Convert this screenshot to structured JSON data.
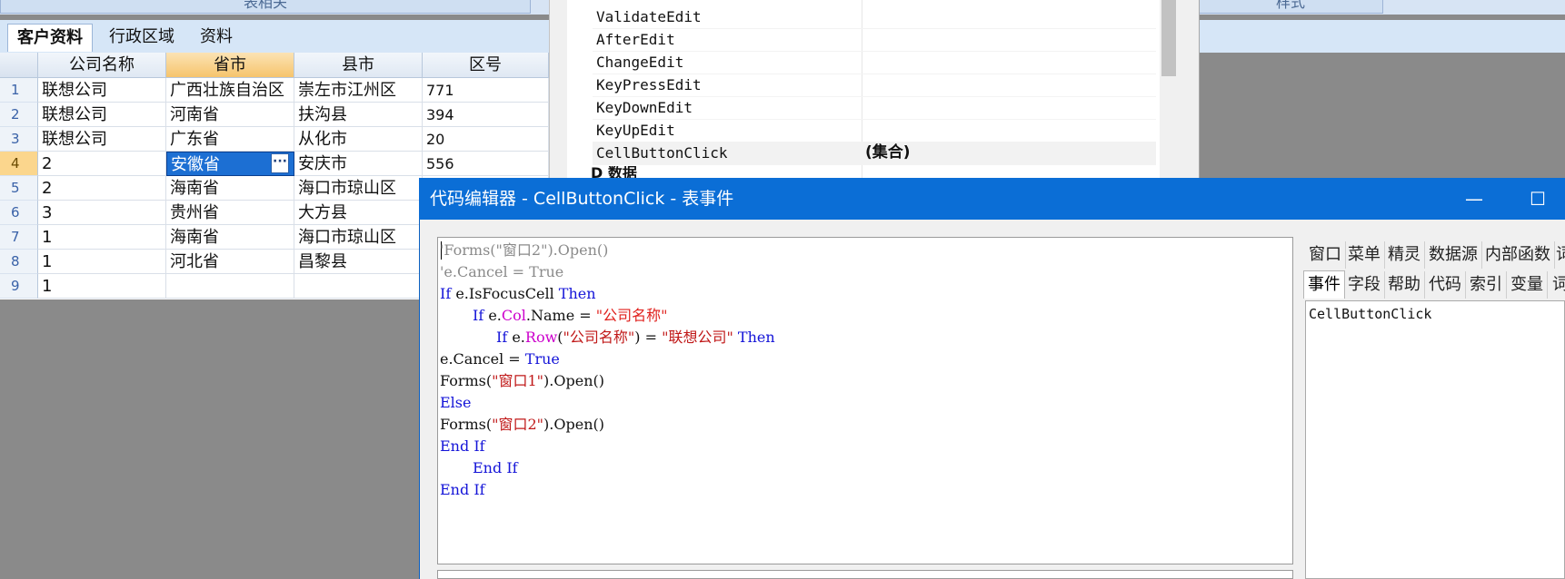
{
  "ribbon": {
    "buttons": [
      "表相关",
      "样式"
    ]
  },
  "tabs": [
    {
      "label": "客户资料",
      "active": true
    },
    {
      "label": "行政区域",
      "active": false
    },
    {
      "label": "资料",
      "active": false
    }
  ],
  "grid": {
    "columns": [
      "公司名称",
      "省市",
      "县市",
      "区号"
    ],
    "selected_column": "省市",
    "rows": [
      {
        "n": "1",
        "c1": "联想公司",
        "c2": "广西壮族自治区",
        "c3": "崇左市江州区",
        "c4": "771"
      },
      {
        "n": "2",
        "c1": "联想公司",
        "c2": "河南省",
        "c3": "扶沟县",
        "c4": "394"
      },
      {
        "n": "3",
        "c1": "联想公司",
        "c2": "广东省",
        "c3": "从化市",
        "c4": "20"
      },
      {
        "n": "4",
        "c1": "2",
        "c2": "安徽省",
        "c3": "安庆市",
        "c4": "556"
      },
      {
        "n": "5",
        "c1": "2",
        "c2": "海南省",
        "c3": "海口市琼山区",
        "c4": ""
      },
      {
        "n": "6",
        "c1": "3",
        "c2": "贵州省",
        "c3": "大方县",
        "c4": ""
      },
      {
        "n": "7",
        "c1": "1",
        "c2": "海南省",
        "c3": "海口市琼山区",
        "c4": ""
      },
      {
        "n": "8",
        "c1": "1",
        "c2": "河北省",
        "c3": "昌黎县",
        "c4": ""
      },
      {
        "n": "9",
        "c1": "1",
        "c2": "",
        "c3": "",
        "c4": ""
      }
    ],
    "cell_button_glyph": "···"
  },
  "properties": {
    "events": [
      "ValidateEdit",
      "AfterEdit",
      "ChangeEdit",
      "KeyPressEdit",
      "KeyDownEdit",
      "KeyUpEdit",
      "CellButtonClick"
    ],
    "cellbuttonclick_value": "(集合)",
    "category_partial": "D 数据"
  },
  "editor": {
    "title": "代码编辑器 - CellButtonClick - 表事件",
    "minimize_glyph": "—",
    "maximize_glyph": "☐",
    "code": {
      "l1_a": "'Forms(",
      "l1_b": "\"窗口2\"",
      "l1_c": ").Open()",
      "l2": "'e.Cancel = True",
      "l3_kw": "If",
      "l3_a": " e.IsFocusCell ",
      "l3_kw2": "Then",
      "l4_kw": "If",
      "l4_a": " e.",
      "l4_prop": "Col",
      "l4_b": ".Name = ",
      "l4_str": "\"公司名称\"",
      "l5_kw": "If",
      "l5_a": " e.",
      "l5_prop": "Row",
      "l5_b": "(",
      "l5_str": "\"公司名称\"",
      "l5_c": ") = ",
      "l5_str2": "\"联想公司\"",
      "l5_kw2": " Then",
      "l6_a": "e.Cancel = ",
      "l6_kw": "True",
      "l7_a": "Forms(",
      "l7_str": "\"窗口1\"",
      "l7_b": ").Open()",
      "l8_kw": "Else",
      "l9_a": "Forms(",
      "l9_str": "\"窗口2\"",
      "l9_b": ").Open()",
      "l10_kw": "End If",
      "l11_kw": "End If",
      "l12_kw": "End If"
    },
    "right_tabs_row1": [
      "窗口",
      "菜单",
      "精灵",
      "数据源",
      "内部函数",
      "词"
    ],
    "right_tabs_row2": [
      "事件",
      "字段",
      "帮助",
      "代码",
      "索引",
      "变量",
      "词"
    ],
    "right_list_item": "CellButtonClick"
  }
}
